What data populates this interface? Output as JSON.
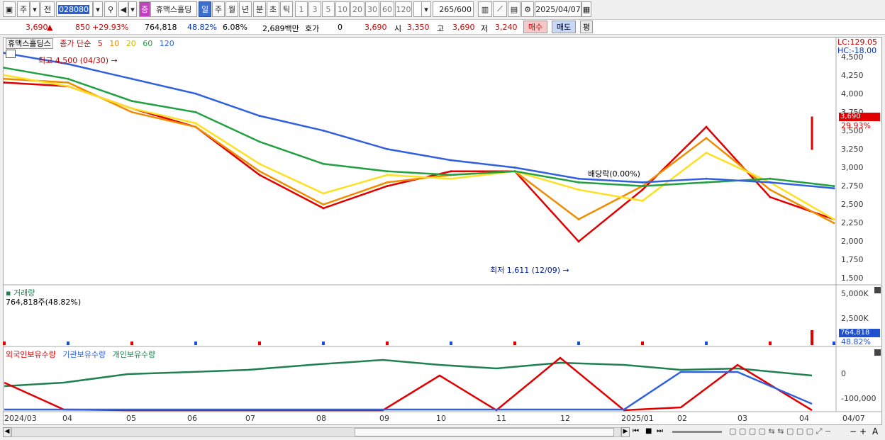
{
  "toolbar": {
    "market_buttons": [
      "주",
      "전"
    ],
    "stock_code": "028080",
    "stock_badge": "증",
    "stock_name": "휴맥스홀딩",
    "period_tabs": [
      "일",
      "주",
      "월",
      "년",
      "분",
      "초",
      "틱"
    ],
    "selected_period": "일",
    "interval_buttons": [
      "1",
      "3",
      "5",
      "10",
      "20",
      "30",
      "60",
      "120"
    ],
    "count_display": "265",
    "count_total": "/600",
    "date": "2025/04/07"
  },
  "quote": {
    "price": "3,690",
    "change": "850",
    "change_pct": "+29.93%",
    "volume": "764,818",
    "vol_ratio": "48.82%",
    "turnover": "6.08%",
    "amount": "2,689백만",
    "hoga_label": "호가",
    "hoga_value": "0",
    "hoga_price": "3,690",
    "open_label": "시",
    "open": "3,350",
    "high_label": "고",
    "high": "3,690",
    "low_label": "저",
    "low": "3,240",
    "buy_label": "매수",
    "sell_label": "매도",
    "avg_label": "평"
  },
  "price_panel": {
    "stock_label": "휴맥스홀딩스",
    "ma_title": "종가 단순",
    "ma_periods": [
      "5",
      "10",
      "20",
      "60",
      "120"
    ],
    "ma_colors": [
      "#e00000",
      "#f08c00",
      "#ffe020",
      "#20a040",
      "#3060e0"
    ],
    "lc": "LC:129.05",
    "hc": "HC:-18.00",
    "y_ticks": [
      "4,500",
      "4,250",
      "4,000",
      "3,750",
      "3,500",
      "3,250",
      "3,000",
      "2,750",
      "2,500",
      "2,250",
      "2,000",
      "1,750",
      "1,500"
    ],
    "current_price_tag": "3,690",
    "current_pct_tag": "29.93%",
    "high_note": "최고 4,500 (04/30)",
    "low_note": "최저 1,611 (12/09)",
    "ex_rights_note": "배당락(0.00%)"
  },
  "volume_panel": {
    "title": "거래량",
    "value": "764,818주(48.82%)",
    "y_ticks": [
      "5,000K",
      "2,500K"
    ],
    "tag_value": "764,818",
    "tag_pct": "48.82%"
  },
  "holding_panel": {
    "legend": [
      "외국인보유수량",
      "기관보유수량",
      "개인보유수량"
    ],
    "legend_colors": [
      "#e00000",
      "#3060e0",
      "#208050"
    ],
    "y_ticks": [
      "0",
      "-100,000"
    ]
  },
  "x_axis": {
    "labels": [
      "2024/03",
      "04",
      "05",
      "06",
      "07",
      "08",
      "09",
      "10",
      "11",
      "12",
      "2025/01",
      "02",
      "03",
      "04"
    ],
    "end_label": "04/07"
  },
  "chart_data": {
    "type": "line",
    "title": "휴맥스홀딩스",
    "ylabel": "",
    "ylim": [
      1500,
      4500
    ],
    "x": [
      "2024/03",
      "04",
      "05",
      "06",
      "07",
      "08",
      "09",
      "10",
      "11",
      "12",
      "2025/01",
      "02",
      "03",
      "04"
    ],
    "series": [
      {
        "name": "5",
        "values": [
          4150,
          4100,
          3800,
          3550,
          2900,
          2450,
          2750,
          2950,
          2950,
          2000,
          2700,
          3550,
          2600,
          2300
        ]
      },
      {
        "name": "10",
        "values": [
          4200,
          4150,
          3750,
          3550,
          2950,
          2500,
          2800,
          2900,
          2950,
          2300,
          2750,
          3400,
          2700,
          2250
        ]
      },
      {
        "name": "20",
        "values": [
          4250,
          4100,
          3800,
          3600,
          3050,
          2650,
          2900,
          2850,
          2950,
          2700,
          2550,
          3200,
          2800,
          2300
        ]
      },
      {
        "name": "60",
        "values": [
          4350,
          4200,
          3900,
          3750,
          3350,
          3050,
          2950,
          2900,
          2950,
          2800,
          2750,
          2800,
          2850,
          2750
        ]
      },
      {
        "name": "120",
        "values": [
          4550,
          4400,
          4200,
          4000,
          3700,
          3500,
          3250,
          3100,
          3000,
          2850,
          2800,
          2850,
          2800,
          2720
        ]
      }
    ]
  }
}
